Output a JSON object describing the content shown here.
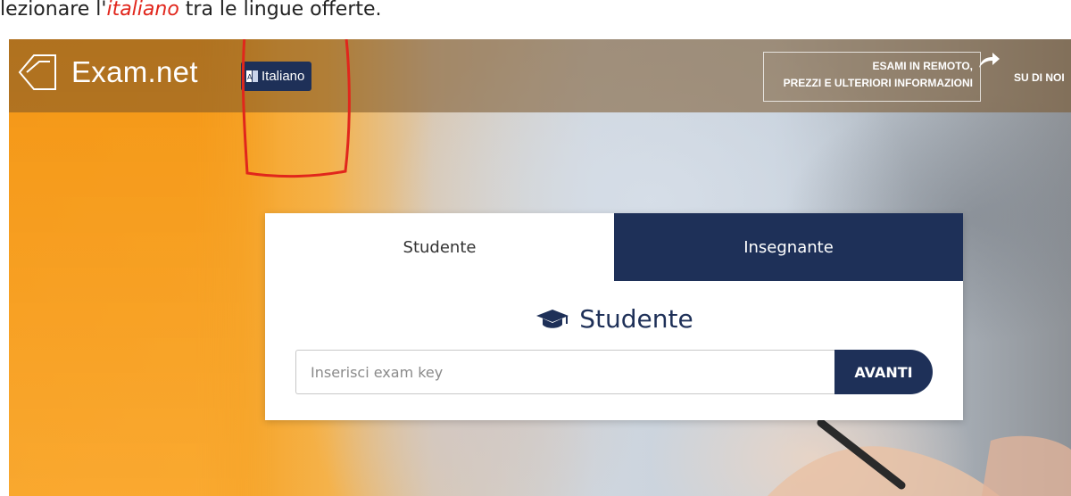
{
  "caption": {
    "prefix": "lezionare l'",
    "highlight": "italiano",
    "suffix": " tra le lingue offerte."
  },
  "header": {
    "brand": "Exam.net",
    "language_button": "Italiano",
    "remote_line1": "ESAMI IN REMOTO,",
    "remote_line2": "PREZZI E ULTERIORI INFORMAZIONI",
    "about": "SU DI NOI"
  },
  "card": {
    "tabs": [
      {
        "label": "Studente"
      },
      {
        "label": "Insegnante"
      }
    ],
    "panel_title": "Studente",
    "input_placeholder": "Inserisci exam key",
    "submit_label": "AVANTI"
  },
  "colors": {
    "navy": "#1e3058",
    "orange": "#f29a1e",
    "annotation_red": "#e1261c"
  },
  "icons": [
    "exam-net-logo-icon",
    "language-flag-icon",
    "share-arrow-icon",
    "graduation-cap-icon"
  ]
}
